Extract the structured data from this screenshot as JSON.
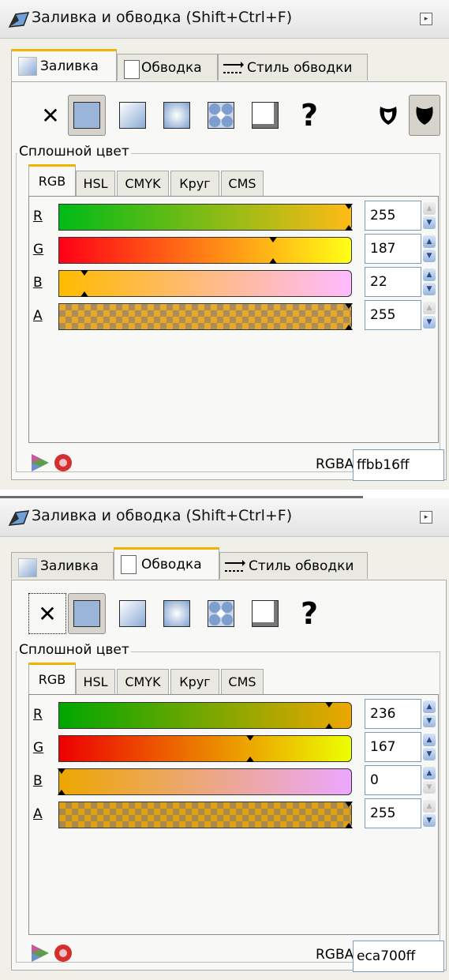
{
  "panels": [
    {
      "title": "Заливка и обводка (Shift+Ctrl+F)",
      "tabs": [
        "Заливка",
        "Обводка",
        "Стиль обводки"
      ],
      "active_tab": 0,
      "group_label": "Сплошной цвет",
      "subtabs": [
        "RGB",
        "HSL",
        "CMYK",
        "Круг",
        "CMS"
      ],
      "channels": [
        {
          "label": "R",
          "value": "255",
          "level": 1.0
        },
        {
          "label": "G",
          "value": "187",
          "level": 0.733
        },
        {
          "label": "B",
          "value": "22",
          "level": 0.086
        },
        {
          "label": "A",
          "value": "255",
          "level": 1.0
        }
      ],
      "rgba_label": "RGBA:",
      "rgba_value": "ffbb16ff",
      "colors": {
        "rgb": "#ffbb16"
      }
    },
    {
      "title": "Заливка и обводка (Shift+Ctrl+F)",
      "tabs": [
        "Заливка",
        "Обводка",
        "Стиль обводки"
      ],
      "active_tab": 1,
      "group_label": "Сплошной цвет",
      "subtabs": [
        "RGB",
        "HSL",
        "CMYK",
        "Круг",
        "CMS"
      ],
      "channels": [
        {
          "label": "R",
          "value": "236",
          "level": 0.925
        },
        {
          "label": "G",
          "value": "167",
          "level": 0.655
        },
        {
          "label": "B",
          "value": "0",
          "level": 0.0
        },
        {
          "label": "A",
          "value": "255",
          "level": 1.0
        }
      ],
      "rgba_label": "RGBA:",
      "rgba_value": "eca700ff",
      "colors": {
        "rgb": "#eca700"
      }
    }
  ],
  "icons": {
    "no_paint": "close-icon",
    "flat": "flat-color-icon",
    "linear": "linear-gradient-icon",
    "radial": "radial-gradient-icon",
    "pattern": "pattern-icon",
    "swatch": "swatch-icon",
    "unset": "question-mark-icon",
    "evenodd": "fill-rule-evenodd-icon",
    "nonzero": "fill-rule-nonzero-icon"
  }
}
